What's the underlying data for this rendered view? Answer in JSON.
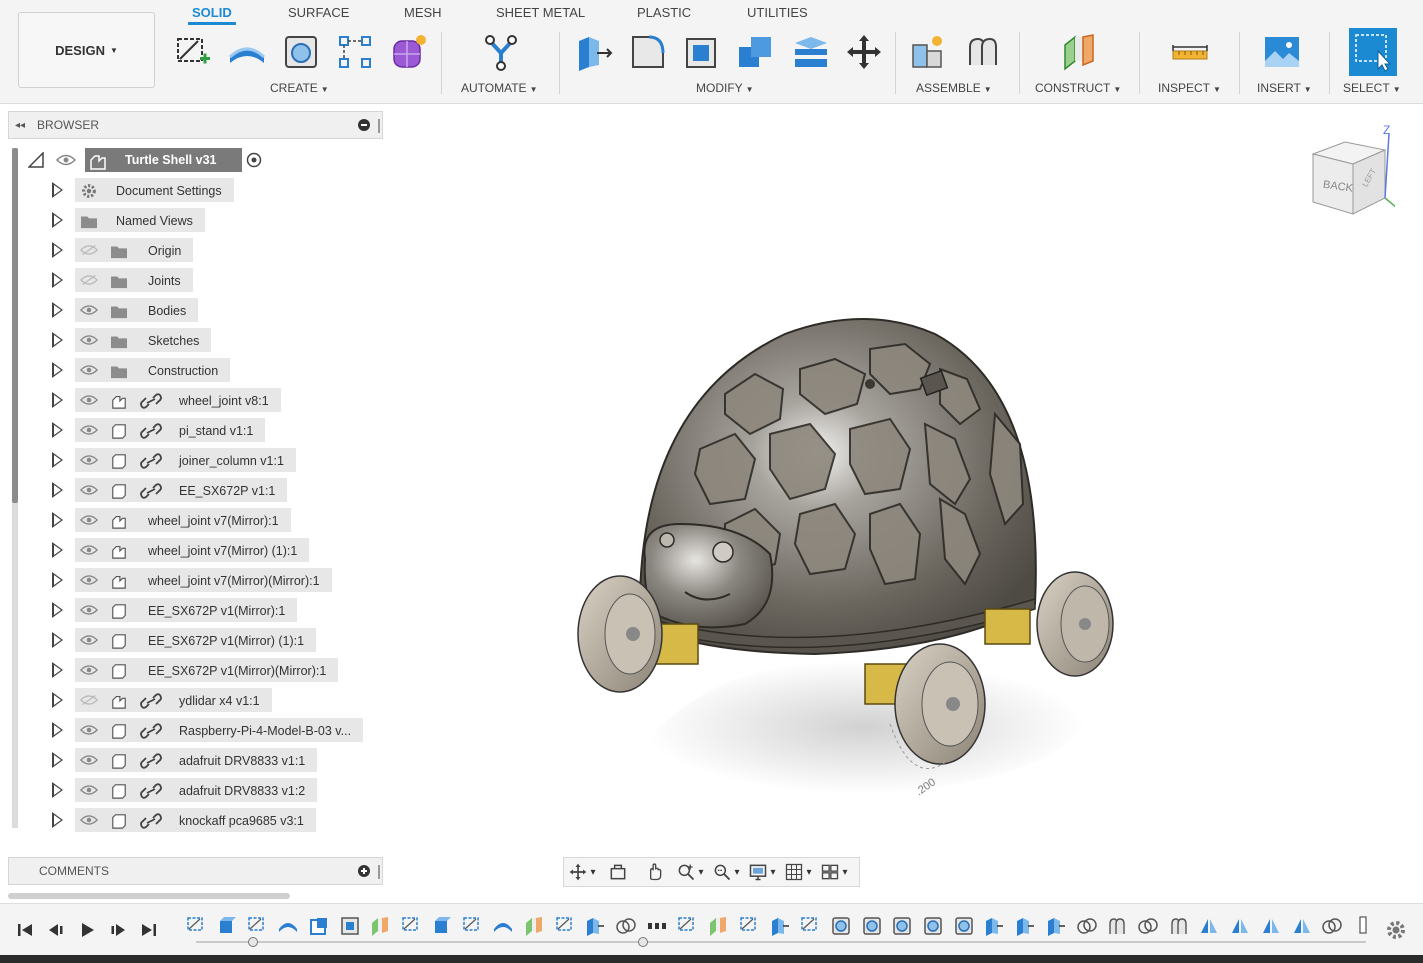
{
  "toolbar": {
    "workspace": "DESIGN",
    "tabs": [
      {
        "label": "SOLID",
        "active": true
      },
      {
        "label": "SURFACE",
        "active": false
      },
      {
        "label": "MESH",
        "active": false
      },
      {
        "label": "SHEET METAL",
        "active": false
      },
      {
        "label": "PLASTIC",
        "active": false
      },
      {
        "label": "UTILITIES",
        "active": false
      }
    ],
    "groups": [
      {
        "label": "CREATE",
        "tools": [
          "create-sketch-icon",
          "extrude-icon",
          "revolve-icon",
          "sketch-pattern-icon",
          "create-form-icon"
        ]
      },
      {
        "label": "AUTOMATE",
        "tools": [
          "automate-icon"
        ]
      },
      {
        "label": "MODIFY",
        "tools": [
          "press-pull-icon",
          "fillet-icon",
          "shell-icon",
          "combine-icon",
          "offset-face-icon",
          "move-icon"
        ]
      },
      {
        "label": "ASSEMBLE",
        "tools": [
          "new-component-icon",
          "joint-icon"
        ]
      },
      {
        "label": "CONSTRUCT",
        "tools": [
          "construct-plane-icon"
        ]
      },
      {
        "label": "INSPECT",
        "tools": [
          "measure-icon"
        ]
      },
      {
        "label": "INSERT",
        "tools": [
          "insert-image-icon"
        ]
      },
      {
        "label": "SELECT",
        "tools": [
          "select-icon"
        ]
      }
    ],
    "accent_color": "#1b8ad3"
  },
  "browser": {
    "title": "BROWSER",
    "root": {
      "label": "Turtle Shell v31"
    },
    "items": [
      {
        "label": "Document Settings",
        "type": "settings",
        "visible": null,
        "linked": false
      },
      {
        "label": "Named Views",
        "type": "folder",
        "visible": null,
        "linked": false
      },
      {
        "label": "Origin",
        "type": "folder",
        "visible": false,
        "linked": false
      },
      {
        "label": "Joints",
        "type": "folder",
        "visible": false,
        "linked": false
      },
      {
        "label": "Bodies",
        "type": "folder",
        "visible": true,
        "linked": false
      },
      {
        "label": "Sketches",
        "type": "folder",
        "visible": true,
        "linked": false
      },
      {
        "label": "Construction",
        "type": "folder",
        "visible": true,
        "linked": false
      },
      {
        "label": "wheel_joint v8:1",
        "type": "assembly",
        "visible": true,
        "linked": true
      },
      {
        "label": "pi_stand v1:1",
        "type": "component",
        "visible": true,
        "linked": true
      },
      {
        "label": "joiner_column v1:1",
        "type": "component",
        "visible": true,
        "linked": true
      },
      {
        "label": "EE_SX672P v1:1",
        "type": "component",
        "visible": true,
        "linked": true
      },
      {
        "label": "wheel_joint v7(Mirror):1",
        "type": "assembly",
        "visible": true,
        "linked": false
      },
      {
        "label": "wheel_joint v7(Mirror) (1):1",
        "type": "assembly",
        "visible": true,
        "linked": false
      },
      {
        "label": "wheel_joint v7(Mirror)(Mirror):1",
        "type": "assembly",
        "visible": true,
        "linked": false
      },
      {
        "label": "EE_SX672P v1(Mirror):1",
        "type": "component",
        "visible": true,
        "linked": false
      },
      {
        "label": "EE_SX672P v1(Mirror) (1):1",
        "type": "component",
        "visible": true,
        "linked": false
      },
      {
        "label": "EE_SX672P v1(Mirror)(Mirror):1",
        "type": "component",
        "visible": true,
        "linked": false
      },
      {
        "label": "ydlidar x4 v1:1",
        "type": "assembly",
        "visible": false,
        "linked": true
      },
      {
        "label": "Raspberry-Pi-4-Model-B-03 v...",
        "type": "component",
        "visible": true,
        "linked": true
      },
      {
        "label": "adafruit DRV8833 v1:1",
        "type": "component",
        "visible": true,
        "linked": true
      },
      {
        "label": "adafruit DRV8833 v1:2",
        "type": "component",
        "visible": true,
        "linked": true
      },
      {
        "label": "knockaff pca9685 v3:1",
        "type": "component",
        "visible": true,
        "linked": true
      }
    ]
  },
  "comments": {
    "title": "COMMENTS"
  },
  "viewcube": {
    "face_back": "BACK",
    "face_left": "LEFT",
    "axis_z": "Z"
  },
  "viewport": {
    "dimension_label": ".200"
  },
  "navbar": {
    "tools": [
      "orbit-icon",
      "look-at-icon",
      "pan-icon",
      "zoom-icon",
      "fit-icon",
      "display-settings-icon",
      "grid-icon",
      "viewports-icon"
    ]
  },
  "timeline": {
    "controls": [
      "go-to-start-icon",
      "step-back-icon",
      "play-icon",
      "step-forward-icon",
      "go-to-end-icon"
    ],
    "features": [
      "sketch",
      "extrude",
      "sketch",
      "revolve",
      "box",
      "shell",
      "plane",
      "sketch",
      "extrude",
      "sketch",
      "revolve",
      "plane",
      "sketch",
      "press-pull",
      "combine",
      "pattern",
      "sketch",
      "plane",
      "sketch",
      "press-pull",
      "sketch",
      "hole",
      "hole",
      "hole",
      "hole",
      "hole",
      "press-pull",
      "press-pull",
      "press-pull",
      "combine",
      "joint",
      "combine",
      "joint",
      "mirror",
      "mirror",
      "mirror",
      "mirror",
      "combine",
      "marker"
    ]
  }
}
